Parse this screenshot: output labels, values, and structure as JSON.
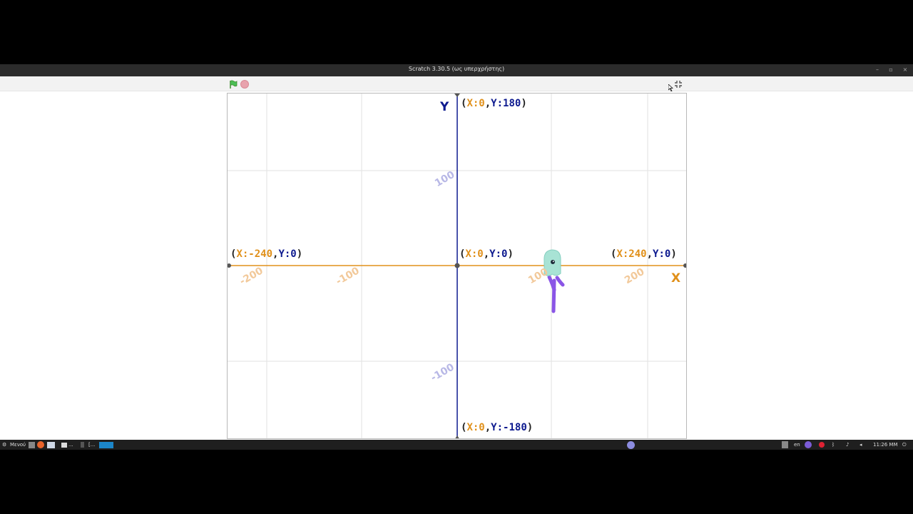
{
  "window": {
    "title": "Scratch 3.30.5 (ως υπερχρήστης)"
  },
  "controls": {
    "green_flag_icon": "green-flag-icon",
    "stop_icon": "stop-icon",
    "fullscreen_icon": "exit-fullscreen-icon"
  },
  "stage": {
    "axis_y_label": "Y",
    "axis_x_label": "X",
    "labels": {
      "top": {
        "x": "X:0",
        "y": "Y:180"
      },
      "left": {
        "x": "X:-240",
        "y": "Y:0"
      },
      "center": {
        "x": "X:0",
        "y": "Y:0"
      },
      "right": {
        "x": "X:240",
        "y": "Y:0"
      },
      "bottom": {
        "x": "X:0",
        "y": "Y:-180"
      }
    },
    "ticks": {
      "x_neg200": "-200",
      "x_neg100": "-100",
      "x_100": "100",
      "x_200": "200",
      "y_100": "100",
      "y_neg100": "-100"
    },
    "colors": {
      "x_axis": "#e0901a",
      "y_axis": "#0d1a8f",
      "grid": "#dcdcdc"
    }
  },
  "taskbar": {
    "menu_label": "Μενού",
    "lang": "en",
    "clock": "11:26 ΜΜ",
    "dots": "...",
    "bracket": "[..."
  }
}
